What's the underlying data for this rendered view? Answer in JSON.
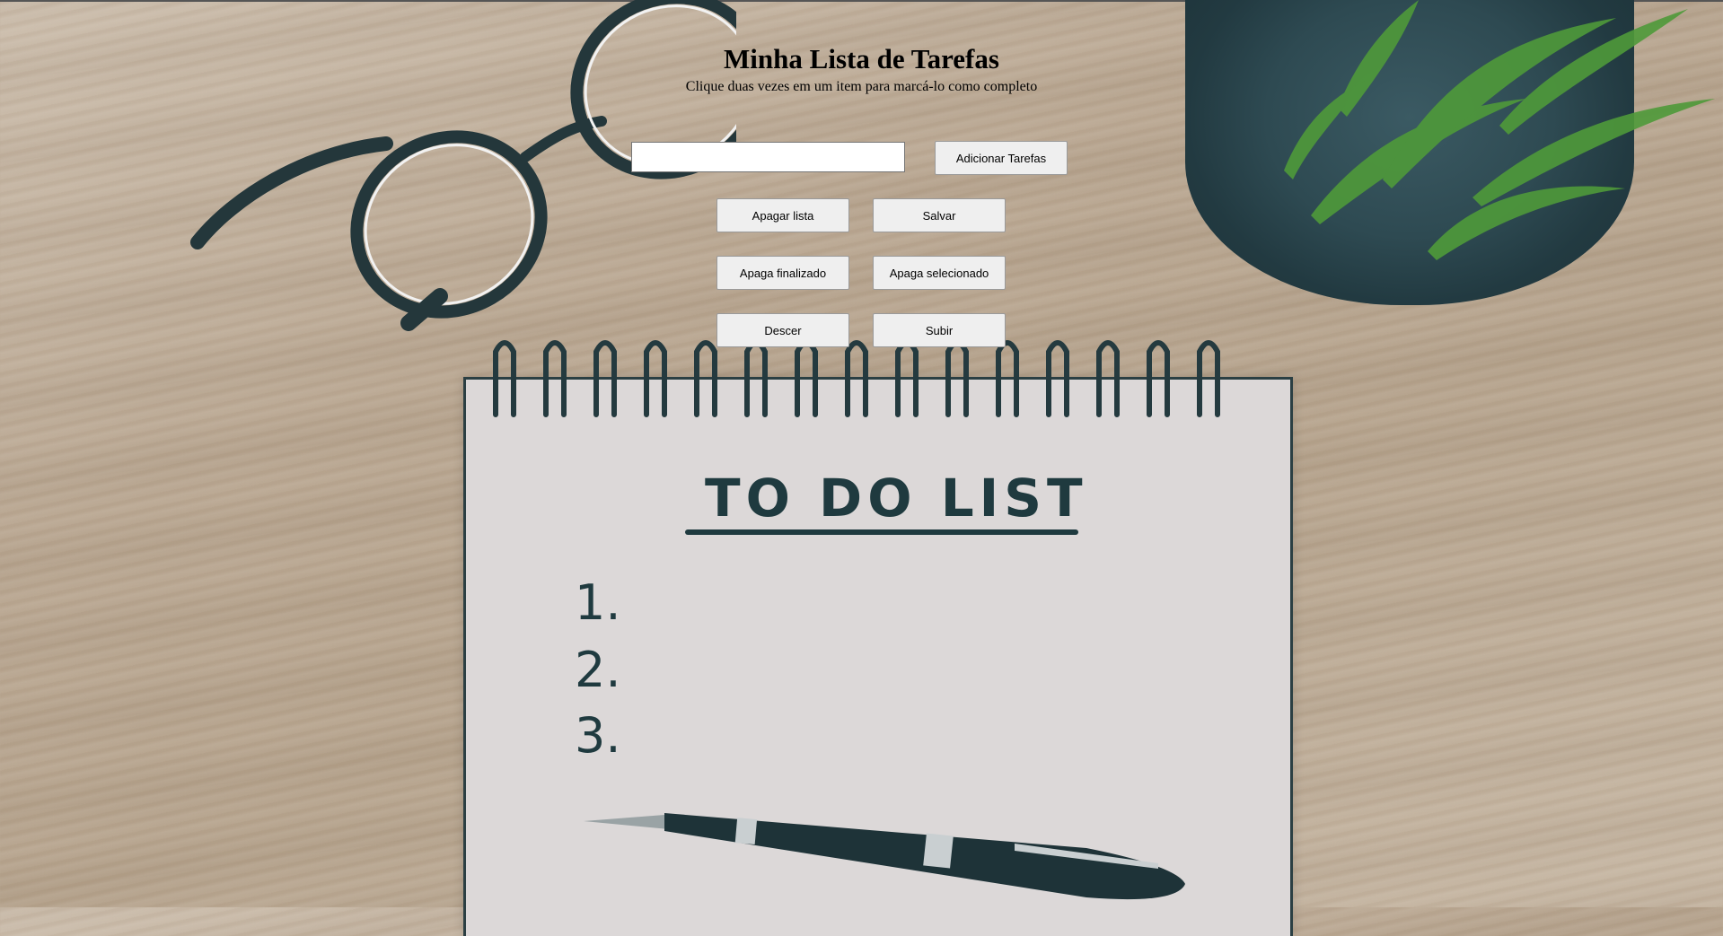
{
  "header": {
    "title": "Minha Lista de Tarefas",
    "subtitle": "Clique duas vezes em um item para marcá-lo como completo"
  },
  "task_input": {
    "value": "",
    "placeholder": ""
  },
  "buttons": {
    "add": "Adicionar Tarefas",
    "clear_list": "Apagar lista",
    "save": "Salvar",
    "remove_completed": "Apaga finalizado",
    "remove_selected": "Apaga selecionado",
    "move_down": "Descer",
    "move_up": "Subir"
  },
  "background_image": {
    "notebook_heading": "TO DO LIST",
    "notebook_numbers": [
      "1.",
      "2.",
      "3."
    ]
  },
  "colors": {
    "wood": "#bba994",
    "notebook_paper": "#dcd8d8",
    "ink": "#1f3a3f",
    "pot": "#2e4a52",
    "leaf": "#4f9a3a",
    "button_bg": "#efefef"
  }
}
